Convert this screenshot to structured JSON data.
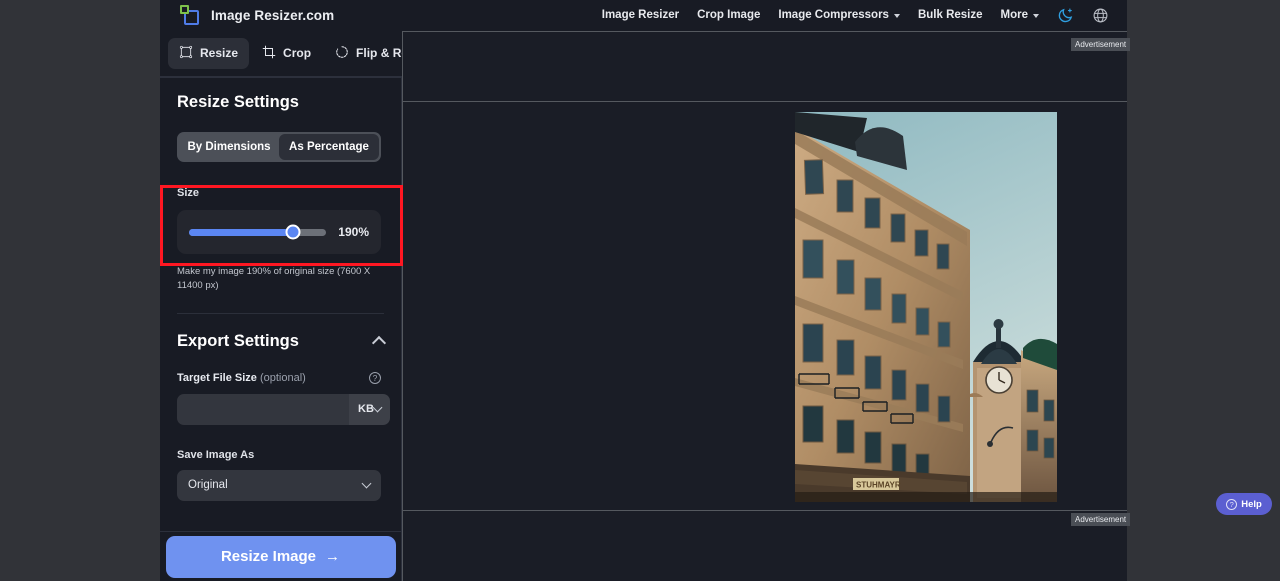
{
  "brand": {
    "name": "Image Resizer.com",
    "logo_icon": "two-squares-logo-icon"
  },
  "nav": {
    "items": [
      {
        "label": "Image Resizer",
        "has_caret": false
      },
      {
        "label": "Crop Image",
        "has_caret": false
      },
      {
        "label": "Image Compressors",
        "has_caret": true
      },
      {
        "label": "Bulk Resize",
        "has_caret": false
      },
      {
        "label": "More",
        "has_caret": true
      }
    ],
    "theme_icon": "moon-sparkle-icon",
    "language_icon": "globe-icon"
  },
  "tabs": [
    {
      "label": "Resize",
      "icon": "resize-frame-icon",
      "active": true
    },
    {
      "label": "Crop",
      "icon": "crop-icon",
      "active": false
    },
    {
      "label": "Flip & Rotate",
      "icon": "rotate-icon",
      "active": false
    }
  ],
  "resize_settings": {
    "title": "Resize Settings",
    "mode_options": [
      {
        "label": "By Dimensions",
        "active": false
      },
      {
        "label": "As Percentage",
        "active": true
      }
    ],
    "size": {
      "label": "Size",
      "value": 190,
      "value_display": "190%",
      "min": 0,
      "max": 250,
      "fill_percent": 76,
      "fill_color": "#5b86f2"
    },
    "hint": "Make my image 190% of original size (7600 X 11400 px)"
  },
  "export_settings": {
    "title": "Export Settings",
    "collapse_icon": "chevron-up-icon",
    "target_file_size": {
      "label": "Target File Size",
      "optional_text": "(optional)",
      "help_icon": "question-mark-icon",
      "value": "",
      "placeholder": "",
      "unit": "KB",
      "unit_caret_icon": "chevron-down-icon"
    },
    "save_image_as": {
      "label": "Save Image As",
      "value": "Original",
      "caret_icon": "chevron-down-icon"
    }
  },
  "cta": {
    "label": "Resize Image",
    "arrow": "→",
    "color": "#6f92f0"
  },
  "ads": {
    "top_label": "Advertisement",
    "bottom_label": "Advertisement"
  },
  "help": {
    "label": "Help",
    "icon": "question-circle-icon",
    "color": "#5b5fd1"
  },
  "preview": {
    "alt": "Historic ornate building facade with clock tower against teal sky"
  }
}
